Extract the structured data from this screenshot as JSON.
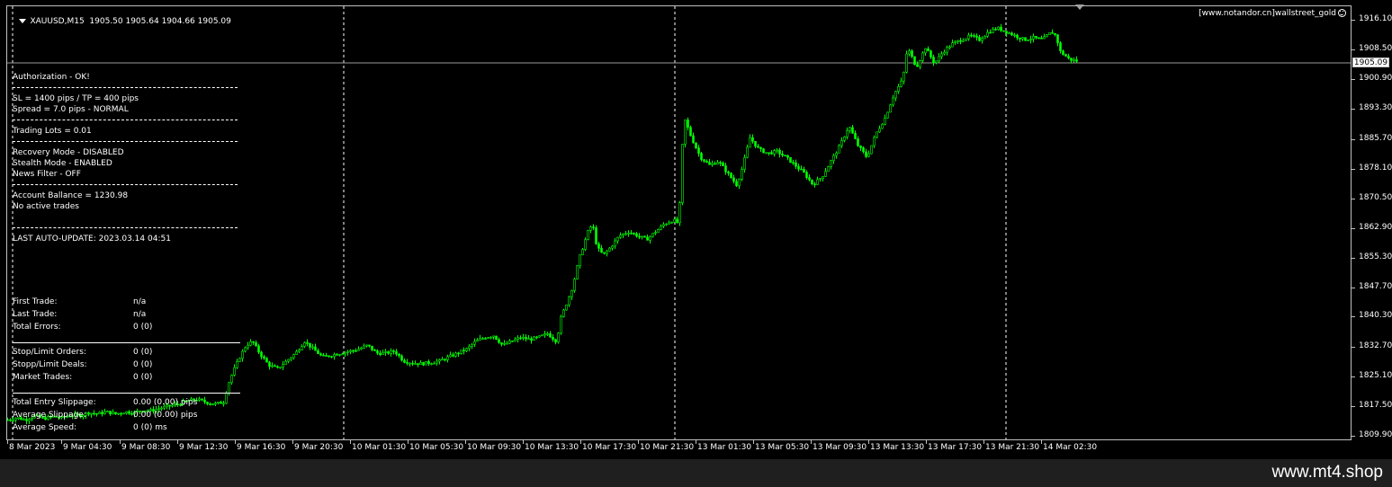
{
  "chart_header": {
    "symbol_timeframe": "XAUUSD,M15",
    "ohlc": "1905.50 1905.64 1904.66 1905.09",
    "watermark": "[www.notandor.cn]wallstreet_gold"
  },
  "price_axis": {
    "labels": [
      "1916.10",
      "1908.50",
      "1900.90",
      "1893.30",
      "1885.70",
      "1878.10",
      "1870.50",
      "1862.90",
      "1855.30",
      "1847.70",
      "1840.30",
      "1832.70",
      "1825.10",
      "1817.50",
      "1809.90"
    ],
    "current_price": "1905.09"
  },
  "time_axis": {
    "labels": [
      "8 Mar 2023",
      "9 Mar 04:30",
      "9 Mar 08:30",
      "9 Mar 12:30",
      "9 Mar 16:30",
      "9 Mar 20:30",
      "10 Mar 01:30",
      "10 Mar 05:30",
      "10 Mar 09:30",
      "10 Mar 13:30",
      "10 Mar 17:30",
      "10 Mar 21:30",
      "13 Mar 01:30",
      "13 Mar 05:30",
      "13 Mar 09:30",
      "13 Mar 13:30",
      "13 Mar 17:30",
      "13 Mar 21:30",
      "14 Mar 02:30"
    ]
  },
  "ea_panel": {
    "authorization": "Authorization - OK!",
    "sl_tp": "SL = 1400 pips / TP = 400 pips",
    "spread": "Spread = 7.0 pips - NORMAL",
    "trading_lots": "Trading Lots = 0.01",
    "recovery_mode": "Recovery Mode - DISABLED",
    "stealth_mode": "Stealth Mode - ENABLED",
    "news_filter": "News Filter - OFF",
    "account_balance": "Account Ballance = 1230.98",
    "active_trades": "No active trades",
    "last_update": "LAST AUTO-UPDATE: 2023.03.14 04:51",
    "stats": [
      {
        "label": "First Trade:",
        "value": "n/a"
      },
      {
        "label": "Last Trade:",
        "value": "n/a"
      },
      {
        "label": "Total Errors:",
        "value": "0 (0)"
      }
    ],
    "orders": [
      {
        "label": "Stop/Limit Orders:",
        "value": "0 (0)"
      },
      {
        "label": "Stopp/Limit Deals:",
        "value": "0 (0)"
      },
      {
        "label": "Market Trades:",
        "value": "0 (0)"
      }
    ],
    "slippage": [
      {
        "label": "Total Entry Slippage:",
        "value": "0.00 (0.00) pips"
      },
      {
        "label": "Average Slippage:",
        "value": "0.00 (0.00) pips"
      },
      {
        "label": "Average Speed:",
        "value": "0 (0) ms"
      }
    ]
  },
  "footer": {
    "brand": "www.mt4.shop"
  },
  "colors": {
    "background": "#000000",
    "candle": "#00ff00",
    "grid_separator": "#ffffff",
    "footer_bg": "#1f1f1f"
  },
  "chart_data": {
    "type": "candlestick",
    "symbol": "XAUUSD",
    "timeframe": "M15",
    "ylim": [
      1809.9,
      1916.1
    ],
    "y_ticks": [
      1916.1,
      1908.5,
      1900.9,
      1893.3,
      1885.7,
      1878.1,
      1870.5,
      1862.9,
      1855.3,
      1847.7,
      1840.3,
      1832.7,
      1825.1,
      1817.5,
      1809.9
    ],
    "current_price": 1905.09,
    "last_bar": {
      "open": 1905.5,
      "high": 1905.64,
      "low": 1904.66,
      "close": 1905.09
    },
    "price_path": [
      [
        0,
        1814
      ],
      [
        10,
        1814.5
      ],
      [
        20,
        1814
      ],
      [
        30,
        1815
      ],
      [
        40,
        1814.3
      ],
      [
        50,
        1814.8
      ],
      [
        60,
        1814.5
      ],
      [
        70,
        1815.2
      ],
      [
        80,
        1815
      ],
      [
        90,
        1815.8
      ],
      [
        100,
        1815.5
      ],
      [
        110,
        1816
      ],
      [
        120,
        1815.5
      ],
      [
        130,
        1816
      ],
      [
        140,
        1815.8
      ],
      [
        150,
        1816.5
      ],
      [
        160,
        1816.3
      ],
      [
        170,
        1817
      ],
      [
        180,
        1817.5
      ],
      [
        190,
        1818
      ],
      [
        200,
        1818.8
      ],
      [
        210,
        1819.2
      ],
      [
        220,
        1818.5
      ],
      [
        230,
        1818
      ],
      [
        240,
        1818.5
      ],
      [
        245,
        1823
      ],
      [
        250,
        1826
      ],
      [
        258,
        1830
      ],
      [
        265,
        1833
      ],
      [
        272,
        1834
      ],
      [
        280,
        1831
      ],
      [
        290,
        1828
      ],
      [
        300,
        1827
      ],
      [
        310,
        1829
      ],
      [
        320,
        1831
      ],
      [
        330,
        1834
      ],
      [
        340,
        1832
      ],
      [
        350,
        1830
      ],
      [
        360,
        1830.5
      ],
      [
        370,
        1831
      ],
      [
        380,
        1831.5
      ],
      [
        390,
        1832
      ],
      [
        400,
        1833
      ],
      [
        410,
        1831
      ],
      [
        420,
        1831
      ],
      [
        430,
        1831.5
      ],
      [
        440,
        1829
      ],
      [
        450,
        1828.5
      ],
      [
        460,
        1828.3
      ],
      [
        470,
        1828.6
      ],
      [
        480,
        1829
      ],
      [
        490,
        1830
      ],
      [
        500,
        1831
      ],
      [
        510,
        1832
      ],
      [
        520,
        1834
      ],
      [
        530,
        1835
      ],
      [
        540,
        1835.5
      ],
      [
        550,
        1833
      ],
      [
        560,
        1834
      ],
      [
        570,
        1835
      ],
      [
        580,
        1834.5
      ],
      [
        590,
        1835
      ],
      [
        600,
        1836
      ],
      [
        610,
        1834
      ],
      [
        615,
        1840
      ],
      [
        620,
        1843
      ],
      [
        628,
        1848
      ],
      [
        635,
        1855
      ],
      [
        645,
        1862
      ],
      [
        650,
        1864
      ],
      [
        655,
        1858
      ],
      [
        662,
        1856
      ],
      [
        670,
        1858
      ],
      [
        680,
        1861
      ],
      [
        690,
        1862
      ],
      [
        700,
        1861
      ],
      [
        710,
        1860
      ],
      [
        720,
        1862
      ],
      [
        730,
        1864
      ],
      [
        740,
        1865
      ],
      [
        746,
        1864
      ],
      [
        750,
        1884
      ],
      [
        752,
        1891
      ],
      [
        760,
        1886
      ],
      [
        770,
        1881
      ],
      [
        780,
        1879
      ],
      [
        790,
        1880
      ],
      [
        800,
        1877
      ],
      [
        810,
        1874
      ],
      [
        815,
        1877
      ],
      [
        825,
        1886
      ],
      [
        835,
        1883
      ],
      [
        845,
        1882
      ],
      [
        855,
        1882.5
      ],
      [
        865,
        1881
      ],
      [
        875,
        1879
      ],
      [
        885,
        1877
      ],
      [
        895,
        1874
      ],
      [
        905,
        1876
      ],
      [
        915,
        1880
      ],
      [
        925,
        1884
      ],
      [
        935,
        1889
      ],
      [
        945,
        1884
      ],
      [
        955,
        1881
      ],
      [
        965,
        1887
      ],
      [
        975,
        1891
      ],
      [
        985,
        1897
      ],
      [
        995,
        1901
      ],
      [
        1000,
        1909
      ],
      [
        1010,
        1904
      ],
      [
        1020,
        1909
      ],
      [
        1030,
        1905
      ],
      [
        1040,
        1908
      ],
      [
        1050,
        1910
      ],
      [
        1060,
        1911
      ],
      [
        1070,
        1912
      ],
      [
        1080,
        1911
      ],
      [
        1090,
        1913
      ],
      [
        1100,
        1914
      ],
      [
        1110,
        1913
      ],
      [
        1120,
        1912
      ],
      [
        1130,
        1911
      ],
      [
        1140,
        1911.5
      ],
      [
        1150,
        1911
      ],
      [
        1160,
        1913
      ],
      [
        1165,
        1912
      ],
      [
        1170,
        1908
      ],
      [
        1180,
        1906
      ],
      [
        1190,
        1905.5
      ],
      [
        1195,
        1905.09
      ]
    ]
  }
}
